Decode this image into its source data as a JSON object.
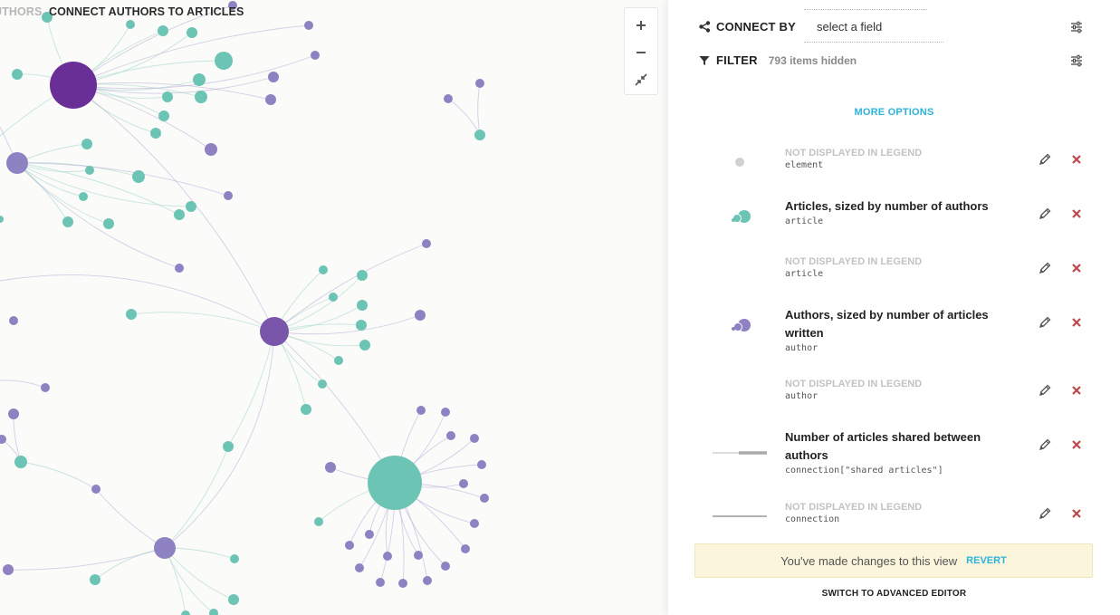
{
  "breadcrumb": {
    "previous": "UTHORS",
    "current": "CONNECT AUTHORS TO ARTICLES"
  },
  "zoom": {
    "zoom_in_icon": "plus-icon",
    "zoom_out_icon": "minus-icon",
    "fit_icon": "collapse-arrows-icon"
  },
  "connect_by": {
    "label": "CONNECT BY",
    "field_placeholder": "select a field",
    "icon": "share-icon",
    "settings_icon": "sliders-icon"
  },
  "filter": {
    "label": "FILTER",
    "hidden_count": "793 items hidden",
    "icon": "funnel-icon",
    "settings_icon": "sliders-icon"
  },
  "more_options": "MORE OPTIONS",
  "legend": [
    {
      "hidden": true,
      "title": "NOT DISPLAYED IN LEGEND",
      "code": "element",
      "sample": "grey-dot"
    },
    {
      "hidden": false,
      "title": "Articles, sized by number of authors",
      "code": "article",
      "sample": "teal-bubbles"
    },
    {
      "hidden": true,
      "title": "NOT DISPLAYED IN LEGEND",
      "code": "article",
      "sample": "none"
    },
    {
      "hidden": false,
      "title": "Authors, sized by number of articles written",
      "code": "author",
      "sample": "purple-bubbles"
    },
    {
      "hidden": true,
      "title": "NOT DISPLAYED IN LEGEND",
      "code": "author",
      "sample": "none"
    },
    {
      "hidden": false,
      "title": "Number of articles shared between authors",
      "code": "connection[\"shared articles\"]",
      "sample": "thickening-line"
    },
    {
      "hidden": true,
      "title": "NOT DISPLAYED IN LEGEND",
      "code": "connection",
      "sample": "grey-line"
    }
  ],
  "changes": {
    "message": "You've made changes to this view",
    "revert": "REVERT"
  },
  "advanced_editor": "SWITCH TO ADVANCED EDITOR",
  "colors": {
    "article_teal": "#6cc4b4",
    "author_purple": "#8f82c2",
    "author_purple_dark": "#6a2f97",
    "link_blue": "#2db3da",
    "delete_red": "#c0474a",
    "banner_bg": "#fbf5dc"
  }
}
